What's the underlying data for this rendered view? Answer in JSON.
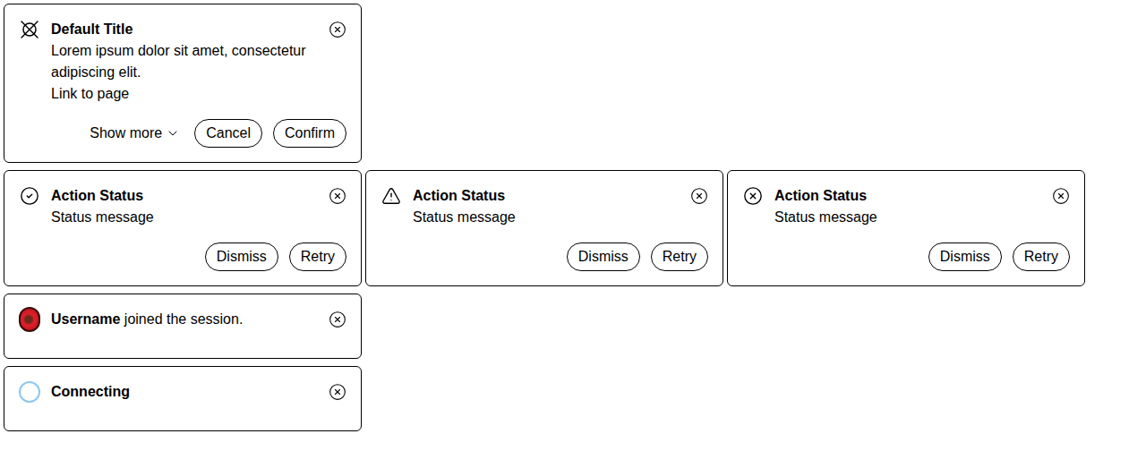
{
  "rows": [
    [
      {
        "kind": "default",
        "title": "Default Title",
        "body": "Lorem ipsum dolor sit amet, consectetur adipiscing elit.",
        "link": "Link to page",
        "expander": {
          "label": "Show more",
          "expanded": false
        },
        "actions": [
          "Cancel",
          "Confirm"
        ]
      }
    ],
    [
      {
        "kind": "success",
        "title": "Action Status",
        "body": "Status message",
        "actions": [
          "Dismiss",
          "Retry"
        ]
      },
      {
        "kind": "warning",
        "title": "Action Status",
        "body": "Status message",
        "actions": [
          "Dismiss",
          "Retry"
        ]
      },
      {
        "kind": "error",
        "title": "Action Status",
        "body": "Status message",
        "actions": [
          "Dismiss",
          "Retry"
        ]
      }
    ],
    [
      {
        "kind": "user",
        "user": "Username",
        "text": " joined the session."
      }
    ],
    [
      {
        "kind": "loading",
        "title": "Connecting"
      }
    ]
  ]
}
